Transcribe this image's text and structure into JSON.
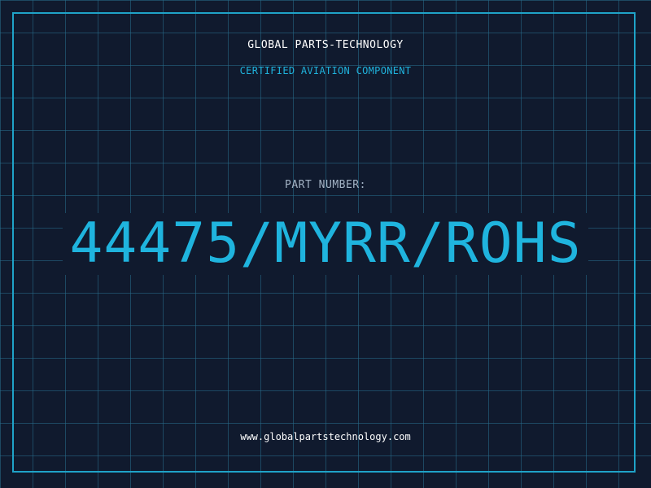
{
  "header": {
    "company_name": "GLOBAL PARTS-TECHNOLOGY",
    "tagline": "CERTIFIED AVIATION COMPONENT"
  },
  "part": {
    "label": "PART NUMBER:",
    "number": "44475/MYRR/ROHS"
  },
  "footer": {
    "website": "www.globalpartstechnology.com"
  },
  "colors": {
    "background": "#101a2e",
    "grid": "#286e8c",
    "accent": "#1fb4de",
    "frame": "#1fa3c8",
    "text": "#ffffff",
    "muted_text": "#a3b3c5"
  }
}
